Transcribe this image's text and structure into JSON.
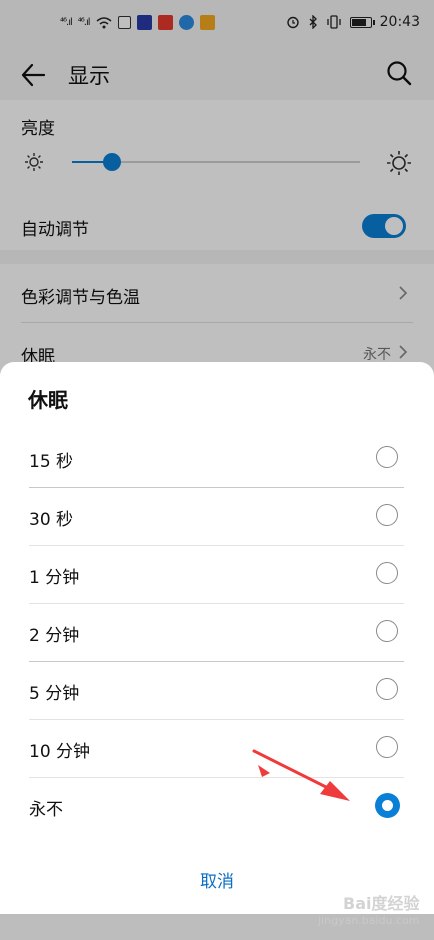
{
  "status_bar": {
    "left_signals": [
      "⁴⁶.ıl",
      "⁴⁶.ıl"
    ],
    "clock": "20:43"
  },
  "colors": {
    "accent": "#0a7fd6",
    "cancel_text": "#0a6fc2",
    "annotation_arrow": "#ef3b3b"
  },
  "header": {
    "title": "显示",
    "back_icon": "back-arrow-icon",
    "search_icon": "search-icon"
  },
  "brightness": {
    "label": "亮度",
    "level_fraction": 0.14,
    "auto_label": "自动调节",
    "auto_enabled": true
  },
  "settings_rows": {
    "color_temp": "色彩调节与色温",
    "sleep": "休眠",
    "sleep_value": "永不"
  },
  "dialog": {
    "title": "休眠",
    "options": [
      {
        "label": "15 秒",
        "selected": false
      },
      {
        "label": "30 秒",
        "selected": false
      },
      {
        "label": "1 分钟",
        "selected": false
      },
      {
        "label": "2 分钟",
        "selected": false
      },
      {
        "label": "5 分钟",
        "selected": false
      },
      {
        "label": "10 分钟",
        "selected": false
      },
      {
        "label": "永不",
        "selected": true
      }
    ],
    "cancel_label": "取消"
  },
  "watermark": {
    "main": "Bai度经验",
    "sub": "jingyan.baidu.com"
  }
}
